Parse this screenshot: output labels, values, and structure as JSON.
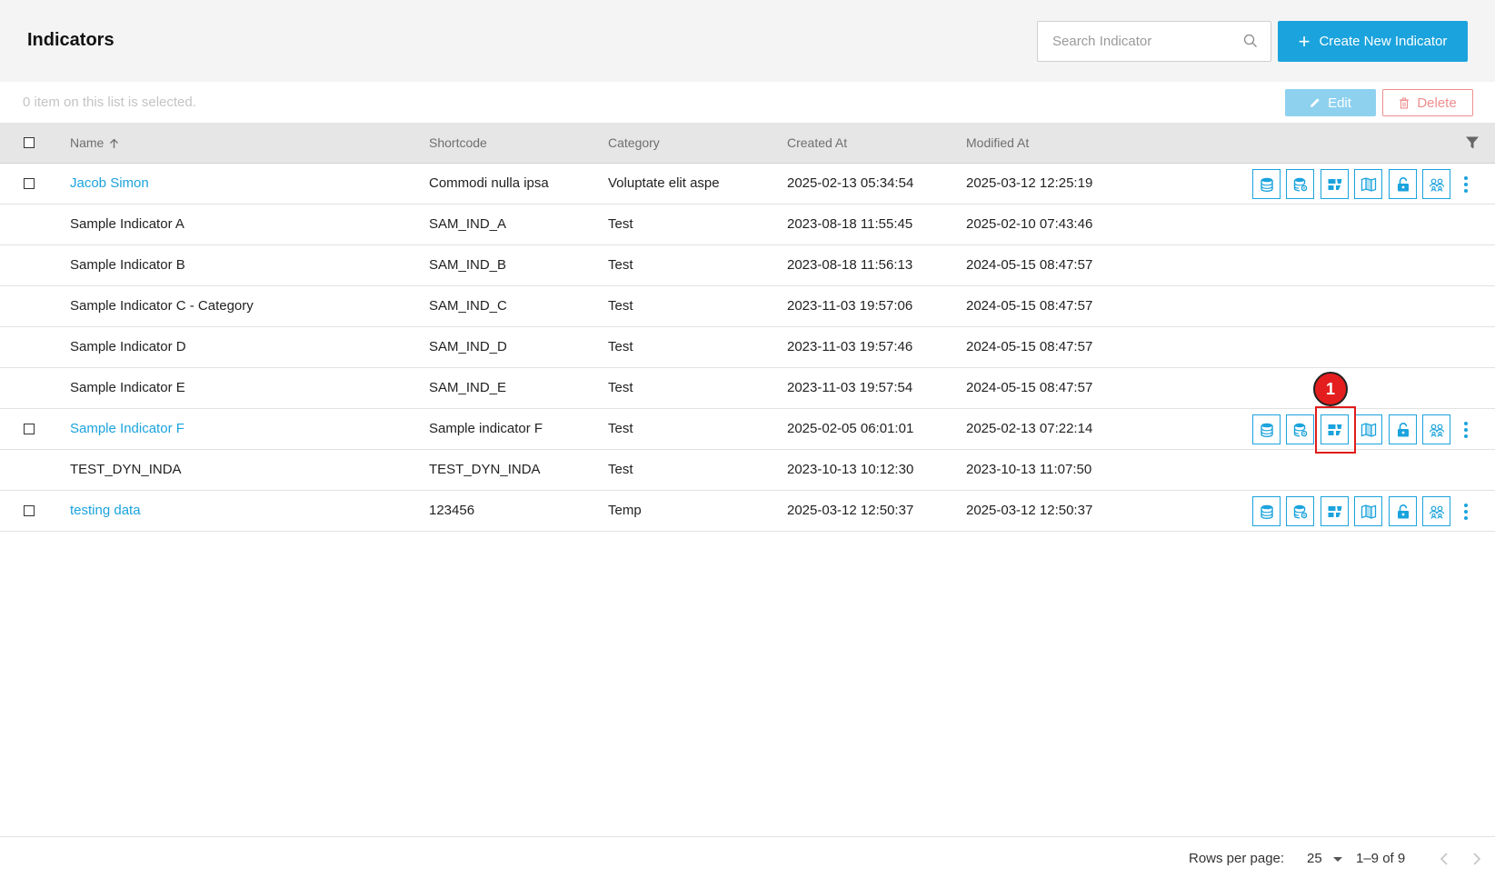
{
  "header": {
    "title": "Indicators",
    "search_placeholder": "Search Indicator",
    "create_label": "Create New Indicator"
  },
  "selection": {
    "text": "0 item on this list is selected.",
    "edit_label": "Edit",
    "delete_label": "Delete"
  },
  "table": {
    "columns": [
      "Name",
      "Shortcode",
      "Category",
      "Created At",
      "Modified At"
    ],
    "sort_column": "Name",
    "sort_direction": "ascending",
    "rows": [
      {
        "name": "Jacob Simon",
        "shortcode": "Commodi nulla ipsa",
        "category": "Voluptate elit aspe",
        "created": "2025-02-13 05:34:54",
        "modified": "2025-03-12 12:25:19",
        "editable": true
      },
      {
        "name": "Sample Indicator A",
        "shortcode": "SAM_IND_A",
        "category": "Test",
        "created": "2023-08-18 11:55:45",
        "modified": "2025-02-10 07:43:46",
        "editable": false
      },
      {
        "name": "Sample Indicator B",
        "shortcode": "SAM_IND_B",
        "category": "Test",
        "created": "2023-08-18 11:56:13",
        "modified": "2024-05-15 08:47:57",
        "editable": false
      },
      {
        "name": "Sample Indicator C - Category",
        "shortcode": "SAM_IND_C",
        "category": "Test",
        "created": "2023-11-03 19:57:06",
        "modified": "2024-05-15 08:47:57",
        "editable": false
      },
      {
        "name": "Sample Indicator D",
        "shortcode": "SAM_IND_D",
        "category": "Test",
        "created": "2023-11-03 19:57:46",
        "modified": "2024-05-15 08:47:57",
        "editable": false
      },
      {
        "name": "Sample Indicator E",
        "shortcode": "SAM_IND_E",
        "category": "Test",
        "created": "2023-11-03 19:57:54",
        "modified": "2024-05-15 08:47:57",
        "editable": false
      },
      {
        "name": "Sample Indicator F",
        "shortcode": "Sample indicator F",
        "category": "Test",
        "created": "2025-02-05 06:01:01",
        "modified": "2025-02-13 07:22:14",
        "editable": true
      },
      {
        "name": "TEST_DYN_INDA",
        "shortcode": "TEST_DYN_INDA",
        "category": "Test",
        "created": "2023-10-13 10:12:30",
        "modified": "2023-10-13 11:07:50",
        "editable": false
      },
      {
        "name": "testing data",
        "shortcode": "123456",
        "category": "Temp",
        "created": "2025-03-12 12:50:37",
        "modified": "2025-03-12 12:50:37",
        "editable": true
      }
    ],
    "row_action_icons": [
      "database-icon",
      "database-settings-icon",
      "data-entry-icon",
      "map-icon",
      "unlock-icon",
      "user-group-icon"
    ]
  },
  "annotation": {
    "marker_label": "1"
  },
  "pagination": {
    "rows_per_page_label": "Rows per page:",
    "rows_per_page": "25",
    "range": "1–9 of 9"
  },
  "colors": {
    "accent": "#1ba3dd",
    "danger": "#ee8e8e",
    "highlight": "#e01b1b"
  }
}
